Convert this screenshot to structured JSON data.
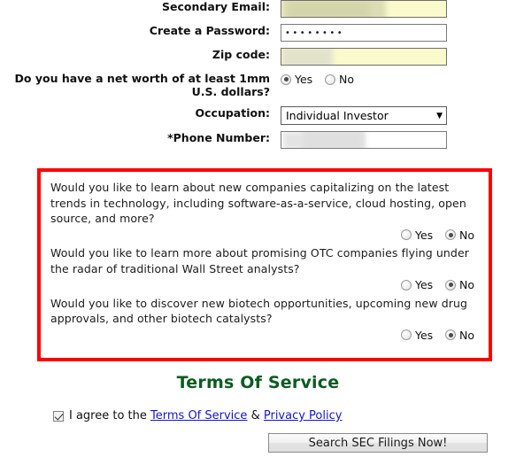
{
  "form": {
    "fields": [
      {
        "label": "Secondary Email:",
        "type": "text",
        "value": "",
        "redacted": true,
        "autofill": true
      },
      {
        "label": "Create a Password:",
        "type": "password",
        "value": "••••••••",
        "redacted": false,
        "autofill": false
      },
      {
        "label": "Zip code:",
        "type": "text",
        "value": "",
        "redacted": true,
        "autofill": true
      }
    ],
    "net_worth": {
      "label": "Do you have a net worth of at least 1mm U.S. dollars?",
      "options": [
        "Yes",
        "No"
      ],
      "selected": "Yes"
    },
    "occupation": {
      "label": "Occupation:",
      "selected": "Individual Investor",
      "arrow": "▼"
    },
    "phone": {
      "label": "*Phone Number:",
      "value": "",
      "redacted": true
    }
  },
  "questions": {
    "items": [
      {
        "text": "Would you like to learn about new companies capitalizing on the latest trends in technology, including software-as-a-service, cloud hosting, open source, and more?",
        "options": [
          "Yes",
          "No"
        ],
        "selected": "No"
      },
      {
        "text": "Would you like to learn more about promising OTC companies flying under the radar of traditional Wall Street analysts?",
        "options": [
          "Yes",
          "No"
        ],
        "selected": "No"
      },
      {
        "text": "Would you like to discover new biotech opportunities, upcoming new drug approvals, and other biotech catalysts?",
        "options": [
          "Yes",
          "No"
        ],
        "selected": "No"
      }
    ],
    "highlight_color": "#ff0000"
  },
  "terms": {
    "heading": "Terms Of Service",
    "heading_color": "#0a5c20",
    "agree_prefix": "I agree to the",
    "tos_link": "Terms Of Service",
    "separator": "&",
    "privacy_link": "Privacy Policy",
    "checked": true
  },
  "submit": {
    "label": "Search SEC Filings Now!"
  }
}
